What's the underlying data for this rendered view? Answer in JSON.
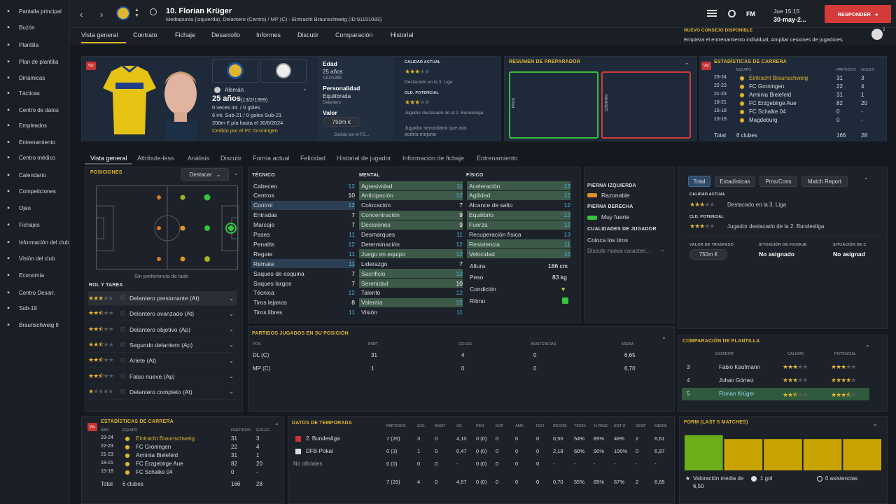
{
  "sidebar": {
    "items": [
      {
        "label": "Pantalla principal",
        "icon": "home-icon"
      },
      {
        "label": "Buzón",
        "icon": "mail-icon"
      },
      {
        "label": "Plantilla",
        "icon": "squad-icon"
      },
      {
        "label": "Plan de plantilla",
        "icon": "plan-icon"
      },
      {
        "label": "Dinámicas",
        "icon": "dynamics-icon"
      },
      {
        "label": "Tácticas",
        "icon": "tactics-icon"
      },
      {
        "label": "Centro de datos",
        "icon": "data-icon"
      },
      {
        "label": "Empleados",
        "icon": "staff-icon"
      },
      {
        "label": "Entrenamiento",
        "icon": "training-icon"
      },
      {
        "label": "Centro médico",
        "icon": "medical-icon"
      },
      {
        "label": "Calendario",
        "icon": "calendar-icon"
      },
      {
        "label": "Competiciones",
        "icon": "trophy-icon"
      },
      {
        "label": "Ojeo",
        "icon": "scout-icon"
      },
      {
        "label": "Fichajes",
        "icon": "transfer-icon"
      },
      {
        "label": "Información del club",
        "icon": "club-icon"
      },
      {
        "label": "Visión del club",
        "icon": "vision-icon"
      },
      {
        "label": "Economía",
        "icon": "finance-icon"
      },
      {
        "label": "Centro Desarr.",
        "icon": "dev-icon"
      },
      {
        "label": "Sub-19",
        "icon": "youth-icon"
      },
      {
        "label": "Braunschweig II",
        "icon": "reserve-icon"
      }
    ]
  },
  "header": {
    "name": "10. Florian Krüger",
    "subtitle": "Mediapunta (Izquierda), Delantero (Centro) / MP (C) - Eintracht Braunschweig (ID:91151083)",
    "fm": "FM",
    "time": "Jue 15:15",
    "date": "30-may-2...",
    "respond": "RESPONDER",
    "advice_title": "NUEVO CONSEJO DISPONIBLE",
    "advice_text": "Empieza el entrenamiento individual, Ampliar cesiones de jugadores",
    "advice_count": "2"
  },
  "nav": {
    "tabs": [
      "Vista general",
      "Contrato",
      "Fichaje",
      "Desarrollo",
      "Informes",
      "Discutir",
      "Comparación",
      "Historial"
    ]
  },
  "profile": {
    "vac": "Vac",
    "nationality": "Alemán",
    "age_big": "25 años",
    "dob": "(13/2/1999)",
    "caps": "0 veces int. / 0 goles",
    "u21": "6 int. Sub-21 / 0 goles Sub-21",
    "wage": "208m € p/a hasta el 30/6/2024",
    "loan": "Cedido por el FC Groningen",
    "age_label": "Edad",
    "age": "25 años",
    "age_dob": "13/2/1999",
    "personality_label": "Personalidad",
    "personality": "Equilibrada",
    "position": "Delantero",
    "value_label": "Valor",
    "value": "750m €",
    "loan_short": "Cedido por el FC...",
    "ca_label": "CALIDAD ACTUAL",
    "ca_note": "Destacado en la 3. Liga",
    "pa_label": "CLD. POTENCIAL",
    "pa_note": "Jugador destacado de la 2. Bundesliga",
    "pa_note2": "Jugador secundario que aún podría mejorar"
  },
  "coach": {
    "title": "RESUMEN DE PREPARADOR",
    "pros": "PROS",
    "cons": "CONTRAS"
  },
  "career_top": {
    "title": "ESTADÍSTICAS DE CARRERA",
    "h_team": "EQUIPO",
    "h_apps": "PARTIDOS",
    "h_goals": "GOLES",
    "rows": [
      {
        "yr": "23-24",
        "team": "Eintracht Braunschweig",
        "apps": "31",
        "goals": "3"
      },
      {
        "yr": "22-23",
        "team": "FC Groningen",
        "apps": "22",
        "goals": "4"
      },
      {
        "yr": "21-23",
        "team": "Arminia Bielefeld",
        "apps": "31",
        "goals": "1"
      },
      {
        "yr": "18-21",
        "team": "FC Erzgebirge Aue",
        "apps": "82",
        "goals": "20"
      },
      {
        "yr": "15-18",
        "team": "FC Schalke 04",
        "apps": "0",
        "goals": "-"
      },
      {
        "yr": "13-15",
        "team": "Magdeburg",
        "apps": "0",
        "goals": "-"
      }
    ],
    "total_label": "Total",
    "total_clubs": "6 clubes",
    "total_apps": "166",
    "total_goals": "28"
  },
  "subtabs": [
    "Vista general",
    "Attribute-less",
    "Análisis",
    "Discutir",
    "Forma actual",
    "Felicidad",
    "Historial de jugador",
    "Información de fichaje",
    "Entrenamiento"
  ],
  "positions": {
    "title": "POSICIONES",
    "dropdown": "Destacar",
    "caption": "Sin preferencia de lado"
  },
  "roles": {
    "title": "ROL Y TAREA",
    "items": [
      {
        "label": "Delantero presionante (At)",
        "stars": 3
      },
      {
        "label": "Delantero avanzado (At)",
        "stars": 2.5
      },
      {
        "label": "Delantero objetivo (Ap)",
        "stars": 2.5
      },
      {
        "label": "Segundo delantero (Ap)",
        "stars": 2.5
      },
      {
        "label": "Ariete (At)",
        "stars": 2.5
      },
      {
        "label": "Falso nueve (Ap)",
        "stars": 2.5
      },
      {
        "label": "Delantero completo (At)",
        "stars": 1
      }
    ]
  },
  "attrs": {
    "tech_title": "TÉCNICO",
    "ment_title": "MENTAL",
    "phys_title": "FÍSICO",
    "tech": [
      [
        "Cabeceo",
        "12"
      ],
      [
        "Centros",
        "10"
      ],
      [
        "Control",
        "12"
      ],
      [
        "Entradas",
        "7"
      ],
      [
        "Marcaje",
        "7"
      ],
      [
        "Pases",
        "11"
      ],
      [
        "Penaltis",
        "12"
      ],
      [
        "Regate",
        "11"
      ],
      [
        "Remate",
        "11"
      ],
      [
        "Saques de esquina",
        "7"
      ],
      [
        "Saques largos",
        "7"
      ],
      [
        "Técnica",
        "12"
      ],
      [
        "Tiros lejanos",
        "8"
      ],
      [
        "Tiros libres",
        "11"
      ]
    ],
    "ment": [
      [
        "Agresividad",
        "11"
      ],
      [
        "Anticipación",
        "12"
      ],
      [
        "Colocación",
        "7"
      ],
      [
        "Concentración",
        "9"
      ],
      [
        "Decisiones",
        "9"
      ],
      [
        "Desmarques",
        "11"
      ],
      [
        "Determinación",
        "12"
      ],
      [
        "Juego en equipo",
        "12"
      ],
      [
        "Liderazgo",
        "7"
      ],
      [
        "Sacrificio",
        "13"
      ],
      [
        "Serenidad",
        "10"
      ],
      [
        "Talento",
        "12"
      ],
      [
        "Valentía",
        "12"
      ],
      [
        "Visión",
        "11"
      ]
    ],
    "phys": [
      [
        "Aceleración",
        "13"
      ],
      [
        "Agilidad",
        "12"
      ],
      [
        "Alcance de salto",
        "12"
      ],
      [
        "Equilibrio",
        "12"
      ],
      [
        "Fuerza",
        "12"
      ],
      [
        "Recuperación física",
        "13"
      ],
      [
        "Resistencia",
        "11"
      ],
      [
        "Velocidad",
        "15"
      ]
    ],
    "height_label": "Altura",
    "height": "186 cm",
    "weight_label": "Peso",
    "weight": "83 kg",
    "cond_label": "Condición",
    "rhythm_label": "Ritmo"
  },
  "feet": {
    "left_title": "PIERNA IZQUIERDA",
    "left": "Razonable",
    "right_title": "PIERNA DERECHA",
    "right": "Muy fuerte",
    "traits_title": "CUALIDADES DE JUGADOR",
    "trait": "Coloca los tiros",
    "discover": "Discutir nueva caracteri..."
  },
  "rating": {
    "tabs": [
      "Total",
      "Estadísticas",
      "Pros/Cons",
      "Match Report"
    ],
    "ca_label": "CALIDAD ACTUAL",
    "ca_note": "Destacado en la 3. Liga",
    "pa_label": "CLD. POTENCIAL",
    "pa_note": "Jugador destacado de la 2. Bundesliga",
    "tv_label": "VALOR DE TRASPASO",
    "tv": "750m €",
    "ts_label": "SITUACIÓN DE FICHAJE",
    "ts": "No asignado",
    "ls_label": "SITUACIÓN DE C",
    "ls": "No asignad"
  },
  "pos_played": {
    "title": "PARTIDOS JUGADOS EN SU POSICIÓN",
    "h": [
      "POS",
      "PART",
      "GOLES",
      "ASISTENCIAS",
      "MEDIA"
    ],
    "rows": [
      [
        "DL (C)",
        "31",
        "4",
        "0",
        "6,65"
      ],
      [
        "MP (C)",
        "1",
        "0",
        "0",
        "6,70"
      ]
    ]
  },
  "squad_cmp": {
    "title": "COMPARACIÓN DE PLANTILLA",
    "h": [
      "JUGADOR",
      "CALIDAD",
      "POTENCIAL"
    ],
    "rows": [
      {
        "rank": "3",
        "name": "Fabio Kaufmann",
        "q": 3,
        "p": 3
      },
      {
        "rank": "4",
        "name": "Johan Gómez",
        "q": 3,
        "p": 4
      },
      {
        "rank": "5",
        "name": "Florian Krüger",
        "q": 2.5,
        "p": 3.5
      }
    ]
  },
  "career_bottom": {
    "title": "ESTADÍSTICAS DE CARRERA",
    "h_year": "AÑO",
    "h_team": "EQUIPO",
    "h_apps": "PARTIDOS",
    "h_goals": "GOLES"
  },
  "season": {
    "title": "DATOS DE TEMPORADA",
    "h": [
      "PARTIDOS",
      "GOL",
      "ASIST",
      "XG",
      "PEN",
      "MJP",
      "AMA",
      "ROJ",
      "REG/90",
      "TIROS",
      "% PASE",
      "ENT G",
      "DESP",
      "MEDIA"
    ],
    "rows": [
      {
        "comp": "2. Bundesliga",
        "v": [
          "7 (26)",
          "3",
          "0",
          "4,10",
          "0 (0)",
          "0",
          "0",
          "0",
          "0,56",
          "54%",
          "85%",
          "48%",
          "2",
          "6,61"
        ]
      },
      {
        "comp": "DFB-Pokal",
        "v": [
          "0 (3)",
          "1",
          "0",
          "0,47",
          "0 (0)",
          "0",
          "0",
          "0",
          "2,18",
          "60%",
          "90%",
          "100%",
          "0",
          "6,97"
        ]
      },
      {
        "comp": "No oficiales",
        "v": [
          "0 (0)",
          "0",
          "0",
          "-",
          "0 (0)",
          "0",
          "0",
          "0",
          "-",
          "-",
          "-",
          "-",
          "-",
          "-"
        ]
      }
    ],
    "total": [
      "7 (29)",
      "4",
      "0",
      "4,57",
      "0 (0)",
      "0",
      "0",
      "0",
      "0,70",
      "55%",
      "85%",
      "67%",
      "2",
      "6,65"
    ]
  },
  "form": {
    "title": "FORM (LAST 5 MATCHES)",
    "avg_label": "Valoración media de",
    "avg": "6,50",
    "goals": "1 gol",
    "assists": "0 asistencias"
  },
  "chart_data": {
    "type": "bar",
    "title": "FORM (LAST 5 MATCHES)",
    "categories": [
      "1",
      "2",
      "3",
      "4",
      "5"
    ],
    "values": [
      0.9,
      0.8,
      0.8,
      0.8,
      0.8
    ],
    "colors": [
      "#6cae1a",
      "#c9a400",
      "#c9a400",
      "#c9a400",
      "#c9a400"
    ]
  }
}
